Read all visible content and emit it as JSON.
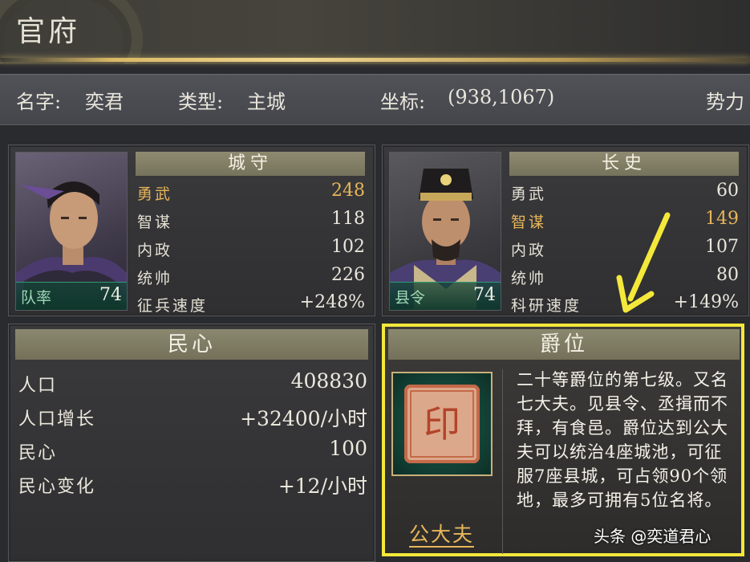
{
  "header": {
    "title": "官府"
  },
  "info": {
    "name_label": "名字:",
    "name_value": "奕君",
    "type_label": "类型:",
    "type_value": "主城",
    "coord_label": "坐标:",
    "coord_value": "(938,1067)",
    "force_label": "势力"
  },
  "guard": {
    "title": "城守",
    "rank_label": "队率",
    "rank_value": "74",
    "stats": [
      {
        "k": "勇武",
        "v": "248"
      },
      {
        "k": "智谋",
        "v": "118"
      },
      {
        "k": "内政",
        "v": "102"
      },
      {
        "k": "统帅",
        "v": "226"
      },
      {
        "k": "征兵速度",
        "v": "+248%"
      }
    ]
  },
  "chief": {
    "title": "长史",
    "rank_label": "县令",
    "rank_value": "74",
    "stats": [
      {
        "k": "勇武",
        "v": "60"
      },
      {
        "k": "智谋",
        "v": "149"
      },
      {
        "k": "内政",
        "v": "107"
      },
      {
        "k": "统帅",
        "v": "80"
      },
      {
        "k": "科研速度",
        "v": "+149%"
      }
    ]
  },
  "people": {
    "title": "民心",
    "rows": [
      {
        "k": "人口",
        "v": "408830"
      },
      {
        "k": "人口增长",
        "v": "+32400/小时"
      },
      {
        "k": "民心",
        "v": "100"
      },
      {
        "k": "民心变化",
        "v": "+12/小时"
      }
    ]
  },
  "rank": {
    "title": "爵位",
    "name": "公大夫",
    "description": "二十等爵位的第七级。又名七大夫。见县令、丞揖而不拜，有食邑。爵位达到公大夫可以统治4座城池，可征服7座县城，可占领90个领地，最多可拥有5位名将。"
  },
  "watermark": "头条 @奕道君心",
  "colors": {
    "highlight": "#e7b65a",
    "outline": "#f4e83a",
    "gold_line": "#d9b866"
  }
}
